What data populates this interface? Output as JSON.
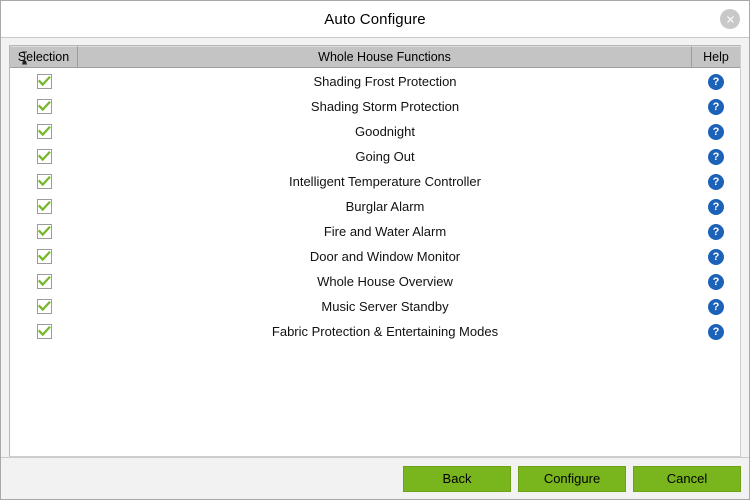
{
  "window": {
    "title": "Auto Configure",
    "close_icon": "close-icon"
  },
  "table": {
    "columns": {
      "selection": "Selection",
      "name": "Whole House Functions",
      "help": "Help"
    },
    "rows": [
      {
        "label": "Shading Frost Protection",
        "checked": true,
        "help_icon": "help-icon"
      },
      {
        "label": "Shading Storm Protection",
        "checked": true,
        "help_icon": "help-icon"
      },
      {
        "label": "Goodnight",
        "checked": true,
        "help_icon": "help-icon"
      },
      {
        "label": "Going Out",
        "checked": true,
        "help_icon": "help-icon"
      },
      {
        "label": "Intelligent Temperature Controller",
        "checked": true,
        "help_icon": "help-icon"
      },
      {
        "label": "Burglar Alarm",
        "checked": true,
        "help_icon": "help-icon"
      },
      {
        "label": "Fire and Water Alarm",
        "checked": true,
        "help_icon": "help-icon"
      },
      {
        "label": "Door and Window Monitor",
        "checked": true,
        "help_icon": "help-icon"
      },
      {
        "label": "Whole House Overview",
        "checked": true,
        "help_icon": "help-icon"
      },
      {
        "label": "Music Server Standby",
        "checked": true,
        "help_icon": "help-icon"
      },
      {
        "label": "Fabric Protection & Entertaining Modes",
        "checked": true,
        "help_icon": "help-icon"
      }
    ]
  },
  "footer": {
    "back_label": "Back",
    "configure_label": "Configure",
    "cancel_label": "Cancel"
  },
  "colors": {
    "button_green": "#79b61d",
    "check_green": "#76b82a",
    "help_blue": "#1c62b9",
    "header_grey": "#c4c4c4",
    "dialog_grey": "#f2f2f2"
  }
}
